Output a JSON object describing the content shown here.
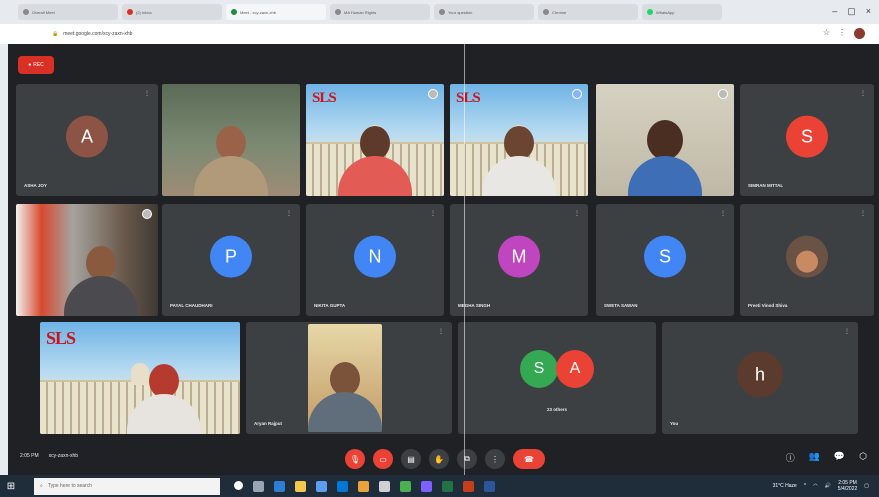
{
  "browser": {
    "tabs": [
      "Overall Meet",
      "(2) Inbox",
      "Meet - xcy-zaxn-xhb",
      "MA Human Rights",
      "Your question",
      "Chrome",
      "WhatsApp"
    ],
    "address": "meet.google.com/xcy-zaxn-xhb",
    "window_controls": [
      "–",
      "▢",
      "×"
    ]
  },
  "meet": {
    "rec_label": "REC",
    "participants": [
      {
        "name": "ASHA JOY",
        "initial": "A",
        "color": "#8d5446",
        "type": "avatar"
      },
      {
        "name": "",
        "type": "video",
        "bg": "office"
      },
      {
        "name": "",
        "type": "video",
        "bg": "sls",
        "logo": "SLS"
      },
      {
        "name": "",
        "type": "video",
        "bg": "sls",
        "logo": "SLS"
      },
      {
        "name": "",
        "type": "video",
        "bg": "wall"
      },
      {
        "name": "SIMRAN MITTAL",
        "initial": "S",
        "color": "#ea4335",
        "type": "avatar"
      },
      {
        "name": "",
        "type": "video",
        "bg": "kitchen"
      },
      {
        "name": "PAYAL CHAUDHARI",
        "initial": "P",
        "color": "#4285f4",
        "type": "avatar"
      },
      {
        "name": "NIKITA GUPTA",
        "initial": "N",
        "color": "#4285f4",
        "type": "avatar"
      },
      {
        "name": "MEGHA SINGH",
        "initial": "M",
        "color": "#c046c0",
        "type": "avatar"
      },
      {
        "name": "SWETA SAWAN",
        "initial": "S",
        "color": "#4285f4",
        "type": "avatar"
      },
      {
        "name": "Preeti Vinod Shiva",
        "type": "photo-avatar"
      },
      {
        "name": "",
        "type": "video",
        "bg": "sls",
        "logo": "SLS"
      },
      {
        "name": "Aryan Rajput",
        "type": "video",
        "bg": "dark"
      },
      {
        "name": "23 others",
        "type": "others",
        "initials": [
          "S",
          "A"
        ]
      },
      {
        "name": "You",
        "initial": "h",
        "color": "#5b3b2e",
        "type": "avatar"
      }
    ],
    "bottom": {
      "time": "2:05 PM",
      "meeting_code": "xcy-zaxn-xhb",
      "controls": [
        "mic-off",
        "camera-off",
        "captions",
        "raise-hand",
        "present",
        "more"
      ],
      "end_label": "end"
    }
  },
  "taskbar": {
    "search_placeholder": "Type here to search",
    "time": "2:05 PM",
    "date": "5/4/2022",
    "weather": "31°C Haze"
  }
}
